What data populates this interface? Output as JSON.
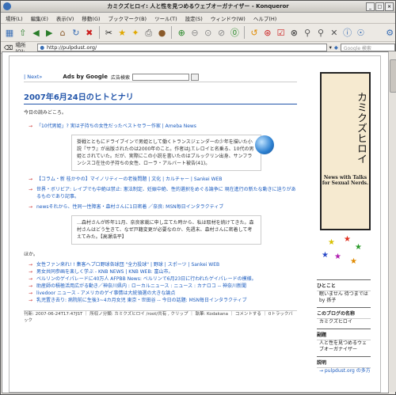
{
  "window": {
    "title": "カミクズヒロイ: 人と性を見つめるウェブオーガナイザー - Konqueror"
  },
  "menu": [
    "場所(L)",
    "編集(E)",
    "表示(V)",
    "移動(G)",
    "ブックマーク(B)",
    "ツール(T)",
    "設定(S)",
    "ウィンドウ(W)",
    "ヘルプ(H)"
  ],
  "toolbar": {
    "icons": [
      "split-view",
      "up",
      "back",
      "forward",
      "home",
      "reload",
      "stop",
      "cut",
      "copy",
      "paste",
      "star",
      "bookmark",
      "print",
      "zoom-in",
      "zoom-out",
      "reset",
      "find",
      "info",
      "refresh",
      "gear",
      "binoculars",
      "security",
      "close",
      "mail",
      "help",
      "konqueror"
    ]
  },
  "location": {
    "label": "場所(O):",
    "url": "http://pulpdust.org/",
    "search_placeholder": "Google 検索"
  },
  "topline": {
    "next": "| Next»",
    "ads": "Ads by Google",
    "ad_search": "広告検索"
  },
  "post": {
    "title": "2007年6月24日のヒトとナリ",
    "intro": "今日の読みどころ。",
    "item1": "「10代男姫」? 実は子持ちの女性だったベストセラー作家 | Ameba News",
    "quote1": "掛戦とともにドライブインで男姫として働くトランスジェンダーの少年を描いた小説『サラ』が出版されたのは2000年のこと。作者はJ.T.レロイと名乗る、10代の男姫とされていた。だが、実際にこの小説を書いたのはブルックリン出身、サンフランシスコ在住の子持ちの女性、ローラ・アルバート被告(41)。",
    "item2": "【コラム・新 桂かやの】マイノリティーの老後問題 | 文化 | カルチャー | Sankei WEB",
    "item3": "世界・ボリビア: レイプでも中絶は禁止: 憲法制定、妊娠中絶、性的選択をめぐる論争に 現在進行の新たな動きに迫りがあるものであり記事。",
    "item4": "newsそれから、性同一性障害・森村さんに1日密着 ／奈良: MSN毎日インタラクティブ",
    "quote2": "…森村さんが昨年11月、奈良家裁に申し立てた時から、私は取材を続けてきた。森村さんはどう生きて、なぜ戸籍変更が必要なのか、先週末、森村さんに密着して考えてみた。【高瀬浩平】",
    "hokani": "ほか。",
    "more": [
      "女性ファン来れ! ! 集客へプロ野球各球団 \"全力投球\" | 野球 | スポーツ | Sankei WEB",
      "男女共同参画を楽しく学ぶ - KNB NEWS | KNB WEB: 富山市。",
      "ベルリンのゲイパレードに40万人 AFPBB News: ベルリンで6月23日に行われたゲイパレードの模様。",
      "助産師の積極活用広がる動き／神奈川県内 : ローカルニュース : ニュース : カナロコ -- 神奈川新聞",
      "livedoor ニュース - アメリカのゲイ事情は大統領選の大きな論点",
      "乳児置き去り: 病院前に生後3~4カ月女児 東京・世田谷 -- 今日の話題: MSN毎日インタラクティブ"
    ],
    "footer": "刊新: 2007-06-24T17:47JST ｜ 所収ノ分類: カミクズヒロイ /root/共有 , クリップ ｜ 執筆: Kodakana ｜ コメントする ｜ 0トラックバック"
  },
  "sidebar": {
    "logo_jp": "カミクズヒロイ",
    "logo_en": "News with Talks for Sexual Nerds.",
    "h1": "ひとこと",
    "t1": "眠いません 待つまでは by 孫子",
    "h2": "このブログの名称",
    "t2": "カミクズヒロイ",
    "h3": "副題",
    "t3": "人と性を見つめるウェブオーガナイザー",
    "h4": "説明",
    "t4": "→ pulpdust.org の多方"
  }
}
